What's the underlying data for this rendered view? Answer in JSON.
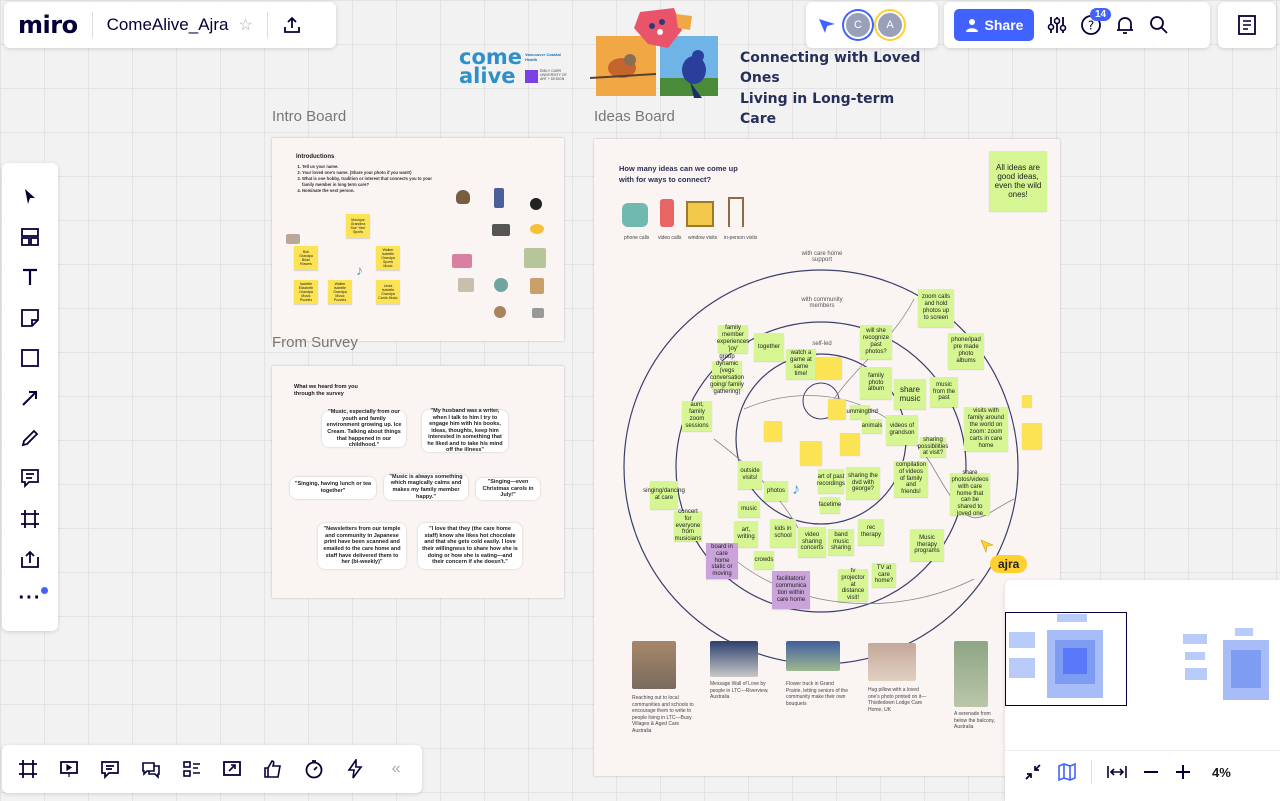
{
  "app": {
    "logo": "miro",
    "board_title": "ComeAlive_Ajra"
  },
  "collaborators": [
    "C",
    "A"
  ],
  "header_actions": {
    "share_label": "Share",
    "help_badge": "14"
  },
  "banner": {
    "logo_line1": "come",
    "logo_line2": "alive",
    "partner1": "Vancouver Coastal Health",
    "partner2": "EMILY CARR UNIVERSITY OF ART + DESIGN",
    "headline_line1": "Connecting with Loved Ones",
    "headline_line2": "Living in Long-term Care"
  },
  "frames": {
    "intro_title": "Intro Board",
    "survey_title": "From Survey",
    "ideas_title": "Ideas Board"
  },
  "intro": {
    "heading": "Introductions",
    "steps": [
      "Tell us your name.",
      "Your loved one's name. (Share your photo if you want!)",
      "What is one hobby, tradition or interest that connects you to your family member in long term care?",
      "Nominate the next person."
    ],
    "stickies": [
      "Monique Grandma Sue 'Yaw' Sports",
      "Bob Grandpa Brian Rowers",
      "Walker Isabelle Grandpa Sports Music",
      "Isabelle Elizabeth Grandpa Music Puzzles",
      "Walker Isabelle Grandpa Music Puzzles",
      "Linda Isabelle Grandpa Cards Music"
    ]
  },
  "survey": {
    "heading_line1": "What we heard from you",
    "heading_line2": "through the survey",
    "quotes": [
      "\"Music, especially from our youth and family environment growing up. Ice Cream. Talking about things that happened in our childhood.\"",
      "\"My husband was a writer, when I talk to him I try to engage him with his books, ideas, thoughts, keep him interested in something that he liked and to take his mind off the illness\"",
      "\"Singing, having lunch or tea together\"",
      "\"Music is always something which magically calms and makes my family member happy.\"",
      "\"Singing—even Christmas carols in July!\"",
      "\"Newsletters from our temple and community in Japanese print have been scanned and emailed to the care home and staff have delivered them to her (bi-weekly)\"",
      "\"I love that they (the care home staff) know she likes hot chocolate and that she gets cold easily. I love their willingness to share how she is doing or how she is eating—and their concern if she doesn't.\""
    ]
  },
  "ideas": {
    "question_line1": "How many ideas can we come up",
    "question_line2": "with for ways to connect?",
    "corner_note": "All ideas are good ideas, even the wild ones!",
    "devices": [
      "phone calls",
      "video calls",
      "window visits",
      "in-person visits"
    ],
    "rings": [
      "with care home support",
      "with community members",
      "self-led"
    ],
    "stickies_green": [
      "together",
      "watch a game at same time!",
      "will she recognize past photos?",
      "family photo album",
      "share music",
      "zoom calls and hold photos up to screen",
      "phone/ipad pre made photo albums",
      "music from the past",
      "visits with family around the world on zoom: zoom carts in care home",
      "videos of grandson",
      "compilation of videos of family and friends!",
      "share photos/videos with care home that can be shared to loved one",
      "sharing the dvd with george?",
      "family member experiences 'joy'",
      "group dynamic (vegs conversation going/ family gathering)",
      "aunt, family zoom sessions",
      "outside visits!",
      "photos",
      "art, writing",
      "kids in school",
      "video sharing concerts",
      "band music sharing",
      "rec therapy",
      "TV at care home?",
      "tv projector at distance visit!",
      "Music therapy programs",
      "concert for everyone from musicians",
      "singing/dancing at care",
      "music",
      "crowds",
      "facetime",
      "sharing possibilities at visit?",
      "Hummingbird",
      "animals",
      "art of past recordings"
    ],
    "stickies_purple": [
      "board in care home static or moving",
      "facilitators/ communica tion within care home"
    ],
    "cursor_user": "ajra",
    "captions": [
      "Reaching out to local communities and schools to encourage them to write to people living in LTC—Busy Villages & Aged Care Australia",
      "Message Wall of Love by people in LTC—Riverview, Australia",
      "Flower truck in Grand Prairie, letting seniors of the community make their own bouquets",
      "Hug pillow with a loved one's photo printed on it—Thistledown Lodge Care Home, UK",
      "A serenade from below the balcony, Australia"
    ]
  },
  "minimap": {
    "zoom_level": "4%"
  },
  "colors": {
    "accent": "#4262ff",
    "sticky_green": "#d5f692",
    "sticky_yellow": "#fbe354",
    "sticky_purple": "#c9a3d9",
    "cursor_yellow": "#ffd02f"
  }
}
